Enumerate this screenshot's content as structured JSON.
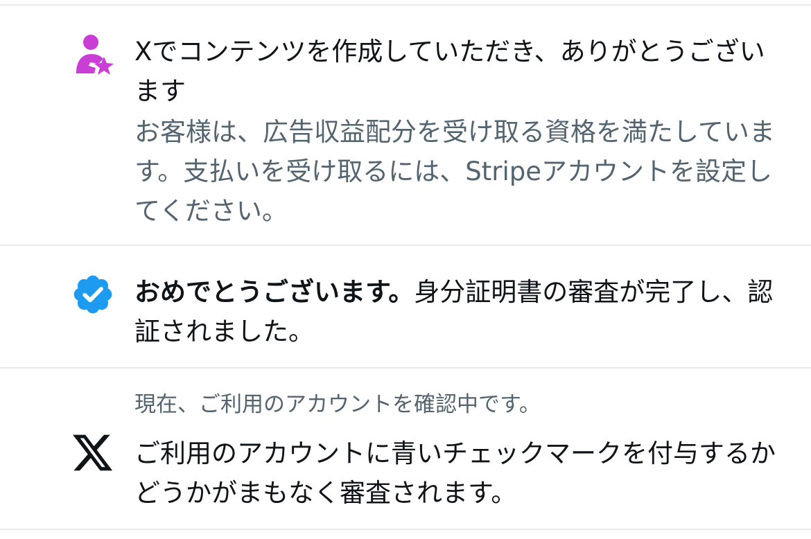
{
  "notifications": [
    {
      "icon": "creator-star-icon",
      "title": "Xでコンテンツを作成していただき、ありがとうございます",
      "description": "お客様は、広告収益配分を受け取る資格を満たしています。支払いを受け取るには、Stripeアカウントを設定してください。"
    },
    {
      "icon": "verified-badge-icon",
      "title_strong": "おめでとうございます。",
      "title_rest": "身分証明書の審査が完了し、認証されました。"
    },
    {
      "icon": "x-logo-icon",
      "subtitle": "現在、ご利用のアカウントを確認中です。",
      "title": "ご利用のアカウントに青いチェックマークを付与するかどうかがまもなく審査されます。"
    }
  ],
  "colors": {
    "creator_icon": "#c93fd6",
    "verified_badge": "#1d9bf0",
    "text_primary": "#0f1419",
    "text_secondary": "#536471",
    "divider": "#e8ebee"
  }
}
